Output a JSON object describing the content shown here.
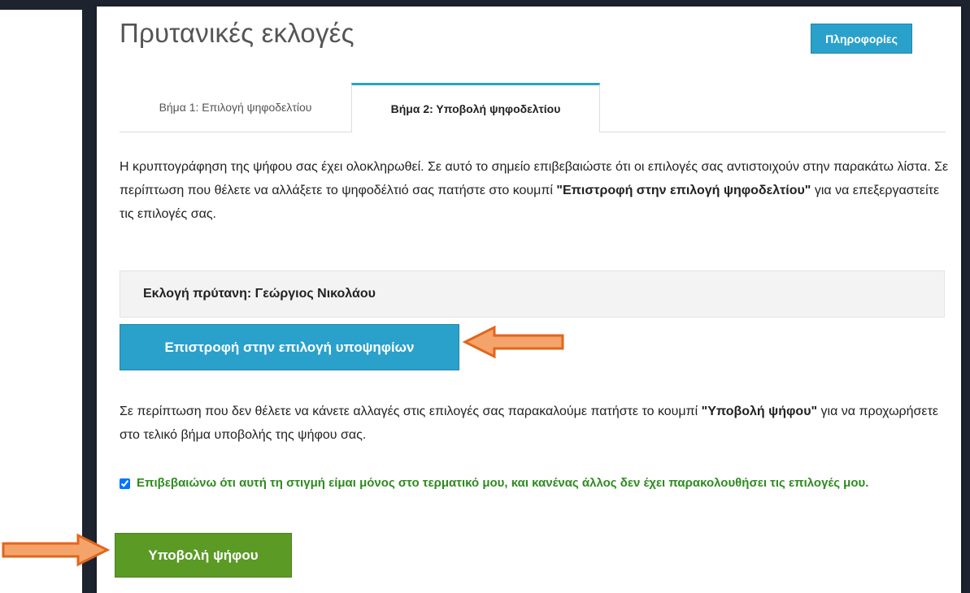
{
  "page": {
    "title": "Πρυτανικές εκλογές",
    "info_button": "Πληροφορίες"
  },
  "tabs": [
    {
      "label": "Βήμα 1: Επιλογή ψηφοδελτίου",
      "active": false
    },
    {
      "label": "Βήμα 2: Υποβολή ψηφοδελτίου",
      "active": true
    }
  ],
  "intro": {
    "text_before": "Η κρυπτογράφηση της ψήφου σας έχει ολοκληρωθεί. Σε αυτό το σημείο επιβεβαιώστε ότι οι επιλογές σας αντιστοιχούν στην παρακάτω λίστα. Σε περίπτωση που θέλετε να αλλάξετε το ψηφοδέλτιό σας πατήστε στο κουμπί ",
    "bold": "\"Επιστροφή στην επιλογή ψηφοδελτίου\"",
    "text_after": " για να επεξεργαστείτε τις επιλογές σας."
  },
  "selection_summary": "Εκλογή πρύτανη: Γεώργιος Νικολάου",
  "back_button": "Επιστροφή στην επιλογή υποψηφίων",
  "submit_info": {
    "text_before": "Σε περίπτωση που δεν θέλετε να κάνετε αλλαγές στις επιλογές σας παρακαλούμε πατήστε το κουμπί ",
    "bold": "\"Υποβολή ψήφου\"",
    "text_after": " για να προχωρήσετε στο τελικό βήμα υποβολής της ψήφου σας."
  },
  "confirmation": {
    "label": "Επιβεβαιώνω ότι αυτή τη στιγμή είμαι μόνος στο τερματικό μου, και κανένας άλλος δεν έχει παρακολουθήσει τις επιλογές μου.",
    "checked": true
  },
  "submit_button": "Υποβολή ψήφου",
  "colors": {
    "accent": "#2aa1cb",
    "submit": "#5a9a25",
    "confirm_text": "#2e8b1f",
    "arrow_fill": "#f4a46a",
    "arrow_stroke": "#e2661b",
    "frame": "#1d2430"
  }
}
